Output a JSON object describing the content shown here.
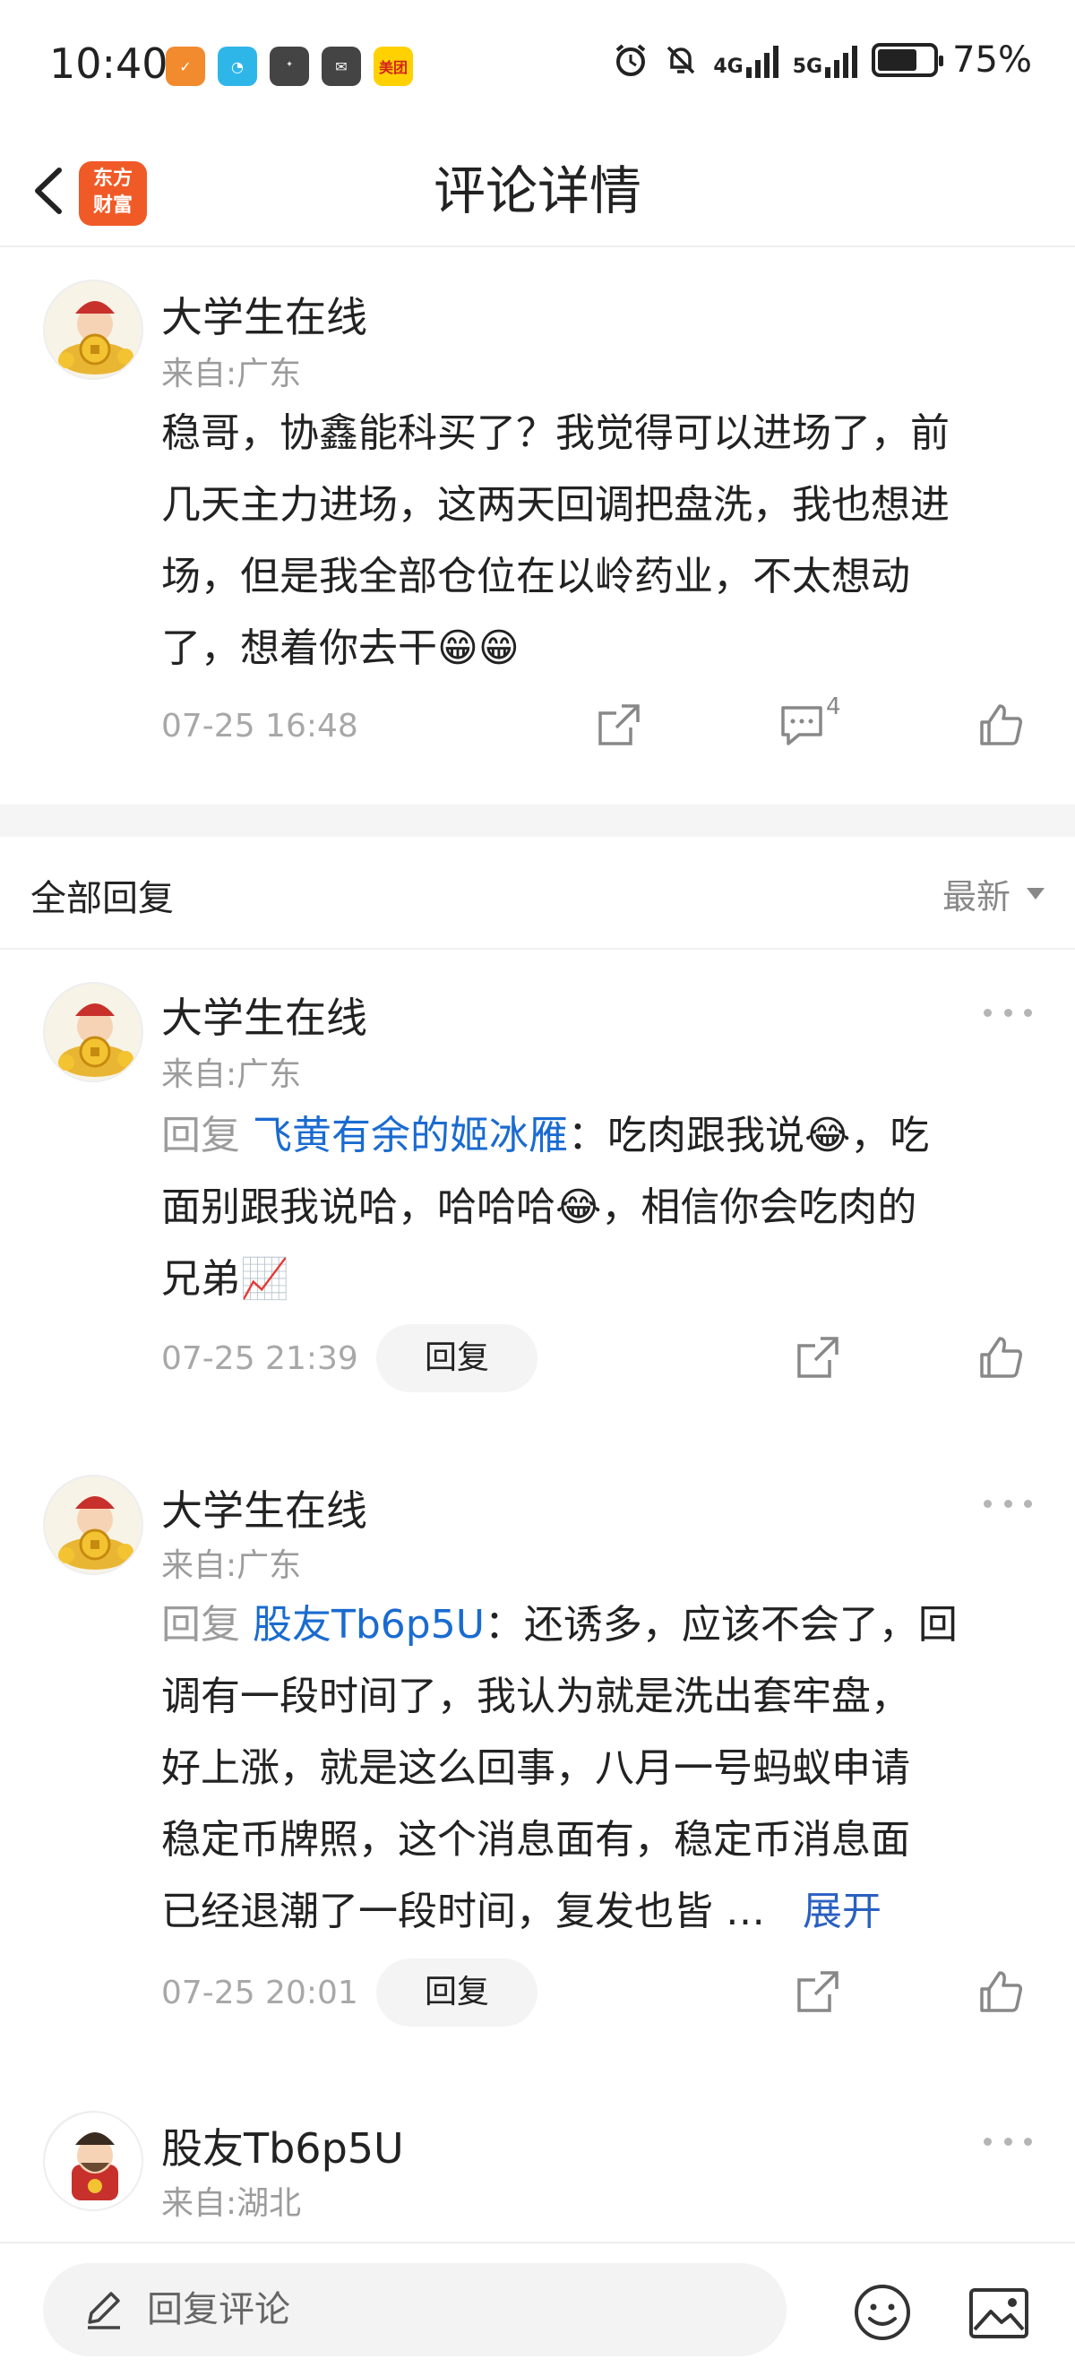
{
  "status_bar": {
    "time": "10:40",
    "apps": [
      {
        "icon": "shield-app-icon",
        "color": "#f28a2e",
        "text": "✓"
      },
      {
        "icon": "browser-app-icon",
        "color": "#2fb6e8",
        "text": "◔"
      },
      {
        "icon": "feather-app-icon",
        "color": "#444444",
        "text": "ᐩ"
      },
      {
        "icon": "wechat-app-icon",
        "color": "#444444",
        "text": "✉"
      },
      {
        "icon": "meituan-app-icon",
        "color": "#ffd100",
        "text": "美团"
      }
    ],
    "net1": "4G",
    "net2": "5G",
    "battery": "75%"
  },
  "header": {
    "logo_line1": "东方",
    "logo_line2": "财富",
    "title": "评论详情"
  },
  "main_post": {
    "user": "大学生在线",
    "region": "来自:广东",
    "lines": [
      "稳哥，协鑫能科买了？我觉得可以进场了，前",
      "几天主力进场，这两天回调把盘洗，我也想进",
      "场，但是我全部仓位在以岭药业，不太想动",
      "了，想着你去干😁😁"
    ],
    "time": "07-25 16:48",
    "comment_count": "4"
  },
  "section": {
    "all_replies": "全部回复",
    "sort": "最新"
  },
  "replies": [
    {
      "user": "大学生在线",
      "region": "来自:广东",
      "reply_prefix": "回复",
      "at_user": "飞黄有余的姬冰雁",
      "line1_rest": "：吃肉跟我说😂，吃",
      "lines": [
        "面别跟我说哈，哈哈哈😂，相信你会吃肉的",
        "兄弟📈"
      ],
      "time": "07-25 21:39",
      "reply_btn": "回复"
    },
    {
      "user": "大学生在线",
      "region": "来自:广东",
      "reply_prefix": "回复",
      "at_user": "股友Tb6p5U",
      "line1_rest": "：还诱多，应该不会了，回",
      "lines": [
        "调有一段时间了，我认为就是洗出套牢盘，",
        "好上涨，就是这么回事，八月一号蚂蚁申请",
        "稳定币牌照，这个消息面有，稳定币消息面"
      ],
      "last_line": "已经退潮了一段时间，复发也皆 …",
      "expand": "展开",
      "time": "07-25 20:01",
      "reply_btn": "回复"
    },
    {
      "user": "股友Tb6p5U",
      "region": "来自:湖北"
    }
  ],
  "bottom_bar": {
    "placeholder": "回复评论"
  }
}
